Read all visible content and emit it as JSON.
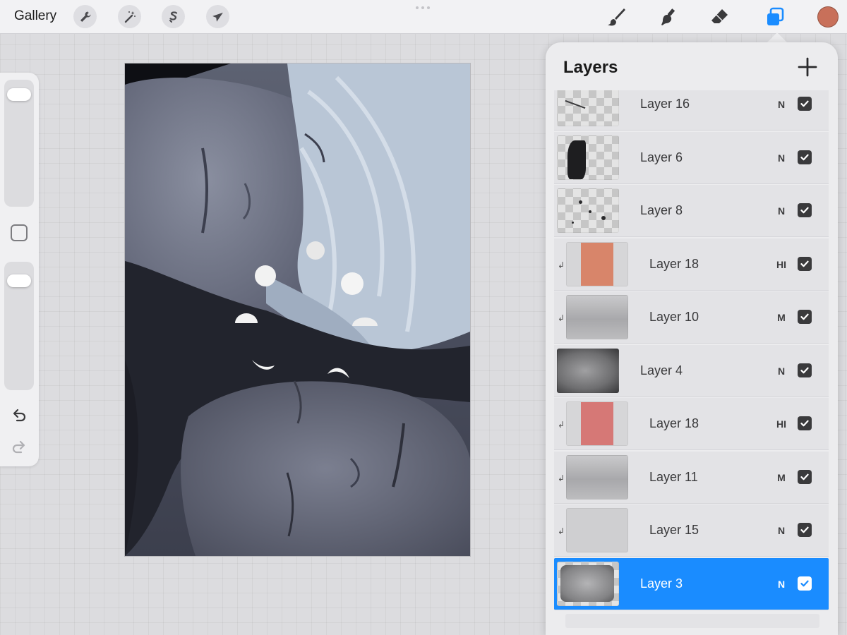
{
  "topbar": {
    "gallery_label": "Gallery",
    "left_tools": [
      {
        "name": "actions",
        "icon": "wrench-icon"
      },
      {
        "name": "adjustments",
        "icon": "magic-wand-icon"
      },
      {
        "name": "selection",
        "icon": "selection-s-icon"
      },
      {
        "name": "transform",
        "icon": "arrow-cursor-icon"
      }
    ],
    "right_tools": [
      {
        "name": "brush",
        "icon": "brush-icon"
      },
      {
        "name": "smudge",
        "icon": "smudge-finger-icon"
      },
      {
        "name": "eraser",
        "icon": "eraser-icon"
      },
      {
        "name": "layers",
        "icon": "layers-icon",
        "active": true
      }
    ],
    "active_color": "#c8705a"
  },
  "sidebar": {
    "brush_size_level": 0.0,
    "opacity_level": 0.0,
    "modify_icon": "square-icon",
    "undo_icon": "undo-icon",
    "redo_icon": "redo-icon"
  },
  "layers_panel": {
    "title": "Layers",
    "add_icon": "plus-icon",
    "accent_color": "#1a8cff",
    "layers": [
      {
        "name": "Layer 16",
        "mode": "N",
        "visible": true,
        "clipped": false,
        "selected": false,
        "thumb": "transparent-strokes"
      },
      {
        "name": "Layer 6",
        "mode": "N",
        "visible": true,
        "clipped": false,
        "selected": false,
        "thumb": "transparent-dark-shape"
      },
      {
        "name": "Layer 8",
        "mode": "N",
        "visible": true,
        "clipped": false,
        "selected": false,
        "thumb": "transparent-specks"
      },
      {
        "name": "Layer 18",
        "mode": "HI",
        "visible": true,
        "clipped": true,
        "selected": false,
        "thumb": "orange-fill",
        "fill": "#d8856a"
      },
      {
        "name": "Layer 10",
        "mode": "M",
        "visible": true,
        "clipped": true,
        "selected": false,
        "thumb": "gray-cloud"
      },
      {
        "name": "Layer 4",
        "mode": "N",
        "visible": true,
        "clipped": false,
        "selected": false,
        "thumb": "face-painting"
      },
      {
        "name": "Layer 18",
        "mode": "HI",
        "visible": true,
        "clipped": true,
        "selected": false,
        "thumb": "pink-fill",
        "fill": "#d67876"
      },
      {
        "name": "Layer 11",
        "mode": "M",
        "visible": true,
        "clipped": true,
        "selected": false,
        "thumb": "gray-cloud"
      },
      {
        "name": "Layer 15",
        "mode": "N",
        "visible": true,
        "clipped": true,
        "selected": false,
        "thumb": "light-gray"
      },
      {
        "name": "Layer 3",
        "mode": "N",
        "visible": true,
        "clipped": false,
        "selected": true,
        "thumb": "face-sketch"
      }
    ]
  }
}
